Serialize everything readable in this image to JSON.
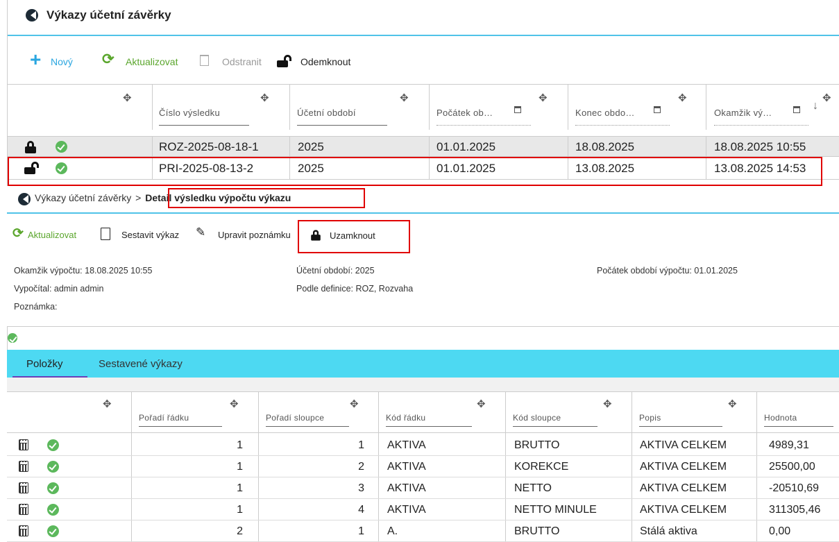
{
  "top": {
    "title": "Výkazy účetní závěrky",
    "toolbar": {
      "new": "Nový",
      "refresh": "Aktualizovat",
      "delete": "Odstranit",
      "unlock": "Odemknout"
    },
    "columns": [
      "Číslo výsledku",
      "Účetní období",
      "Počátek ob…",
      "Konec obdo…",
      "Okamžik vý…"
    ],
    "rows": [
      {
        "number": "ROZ-2025-08-18-1",
        "period": "2025",
        "start": "01.01.2025",
        "end": "18.08.2025",
        "moment": "18.08.2025 10:55",
        "locked": true
      },
      {
        "number": "PRI-2025-08-13-2",
        "period": "2025",
        "start": "01.01.2025",
        "end": "13.08.2025",
        "moment": "13.08.2025 14:53",
        "locked": false
      }
    ]
  },
  "detail": {
    "breadcrumb_parent": "Výkazy účetní závěrky",
    "breadcrumb_sep": ">",
    "breadcrumb_current": "Detail výsledku výpočtu výkazu",
    "toolbar": {
      "refresh": "Aktualizovat",
      "build": "Sestavit výkaz",
      "edit_note": "Upravit poznámku",
      "lock": "Uzamknout"
    },
    "info": {
      "moment": "Okamžik výpočtu: 18.08.2025 10:55",
      "calculated_by": "Vypočítal: admin admin",
      "note": "Poznámka:",
      "period": "Účetní období: 2025",
      "definition": "Podle definice: ROZ, Rozvaha",
      "start": "Počátek období výpočtu: 01.01.2025"
    },
    "tabs": [
      "Položky",
      "Sestavené výkazy"
    ],
    "columns": [
      "Pořadí řádku",
      "Pořadí sloupce",
      "Kód řádku",
      "Kód sloupce",
      "Popis",
      "Hodnota"
    ],
    "rows": [
      {
        "row_order": "1",
        "col_order": "1",
        "row_code": "AKTIVA",
        "col_code": "BRUTTO",
        "desc": "AKTIVA CELKEM",
        "value": "4989,31"
      },
      {
        "row_order": "1",
        "col_order": "2",
        "row_code": "AKTIVA",
        "col_code": "KOREKCE",
        "desc": "AKTIVA CELKEM",
        "value": "25500,00"
      },
      {
        "row_order": "1",
        "col_order": "3",
        "row_code": "AKTIVA",
        "col_code": "NETTO",
        "desc": "AKTIVA CELKEM",
        "value": "-20510,69"
      },
      {
        "row_order": "1",
        "col_order": "4",
        "row_code": "AKTIVA",
        "col_code": "NETTO MINULE",
        "desc": "AKTIVA CELKEM",
        "value": "311305,46"
      },
      {
        "row_order": "2",
        "col_order": "1",
        "row_code": "A.",
        "col_code": "BRUTTO",
        "desc": "Stálá aktiva",
        "value": "0,00"
      }
    ]
  },
  "colors": {
    "accent": "#4fc3e8",
    "green": "#5ba62d",
    "highlight": "#e00000"
  }
}
